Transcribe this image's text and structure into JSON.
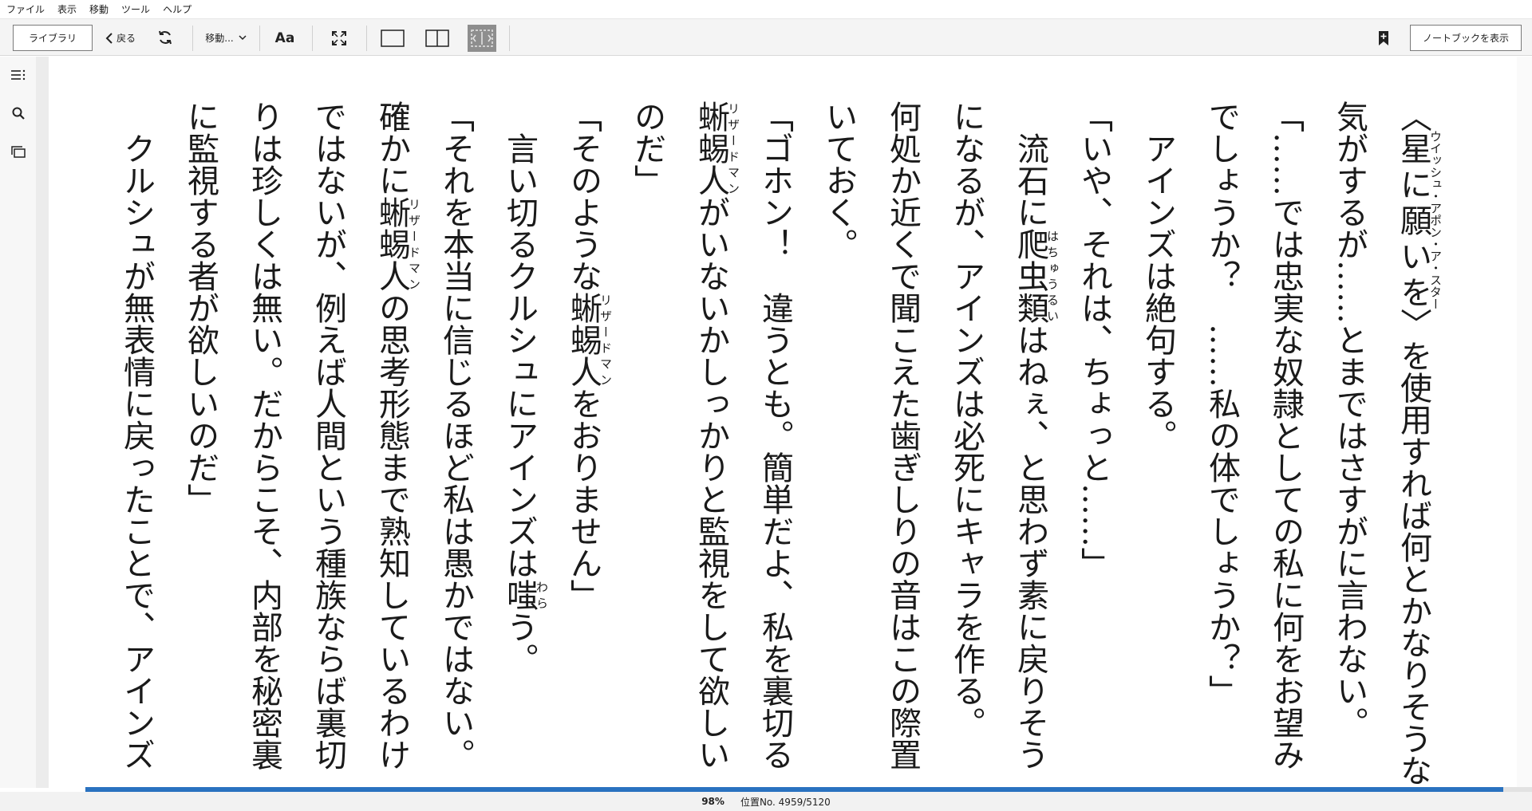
{
  "menu": [
    "ファイル",
    "表示",
    "移動",
    "ツール",
    "ヘルプ"
  ],
  "toolbar": {
    "library_label": "ライブラリ",
    "back_label": "戻る",
    "goto_label": "移動...",
    "font_label": "Aa",
    "notebook_label": "ノートブックを表示"
  },
  "sidebar": {
    "icons": [
      "toc-icon",
      "search-icon",
      "flashcards-icon"
    ]
  },
  "paragraphs": [
    [
      {
        "t": "〈"
      },
      {
        "b": "星に願いを",
        "r": "ウイッシュ・アポン・ア・スター"
      },
      {
        "t": "〉を使用すれば何とかなりそうな気がするが……とまではさすがに言わない。"
      }
    ],
    [
      {
        "t": "「……では忠実な奴隷としての私に何をお望みでしょうか？　……私の体でしょうか？」"
      }
    ],
    [
      {
        "t": "　アインズは絶句する。"
      }
    ],
    [
      {
        "t": "「いや、それは、ちょっと……」"
      }
    ],
    [
      {
        "t": "　流石に"
      },
      {
        "b": "爬虫類",
        "r": "はちゅうるい"
      },
      {
        "t": "はねぇ、と思わず素に戻りそうになるが、アインズは必死にキャラを作る。"
      }
    ],
    [
      {
        "t": "何処か近くで聞こえた歯ぎしりの音はこの際置いておく。"
      }
    ],
    [
      {
        "t": "「ゴホン！　違うとも。簡単だよ、私を裏切る"
      },
      {
        "b": "蜥蜴人",
        "r": "リザードマン"
      },
      {
        "t": "がいないかしっかりと監視をして欲しいのだ」"
      }
    ],
    [
      {
        "t": "「そのような"
      },
      {
        "b": "蜥蜴人",
        "r": "リザードマン"
      },
      {
        "t": "をおりません」"
      }
    ],
    [
      {
        "t": "　言い切るクルシュにアインズは"
      },
      {
        "b": "嗤",
        "r": "わら"
      },
      {
        "t": "う。"
      }
    ],
    [
      {
        "t": "「それを本当に信じるほど私は愚かではない。確かに"
      },
      {
        "b": "蜥蜴人",
        "r": "リザードマン"
      },
      {
        "t": "の思考形態まで熟知しているわけではないが、例えば人間という種族ならば裏切りは珍しくは無い。だからこそ、内部を秘密裏に監視する者が欲しいのだ」"
      }
    ],
    [
      {
        "t": "　クルシュが無表情に戻ったことで、アインズ"
      }
    ]
  ],
  "progress": {
    "percent_label": "98%",
    "percent": 98,
    "location_label": "位置No. 4959/5120"
  },
  "colors": {
    "accent": "#2a72c0",
    "toolbar_bg": "#f4f4f4"
  }
}
